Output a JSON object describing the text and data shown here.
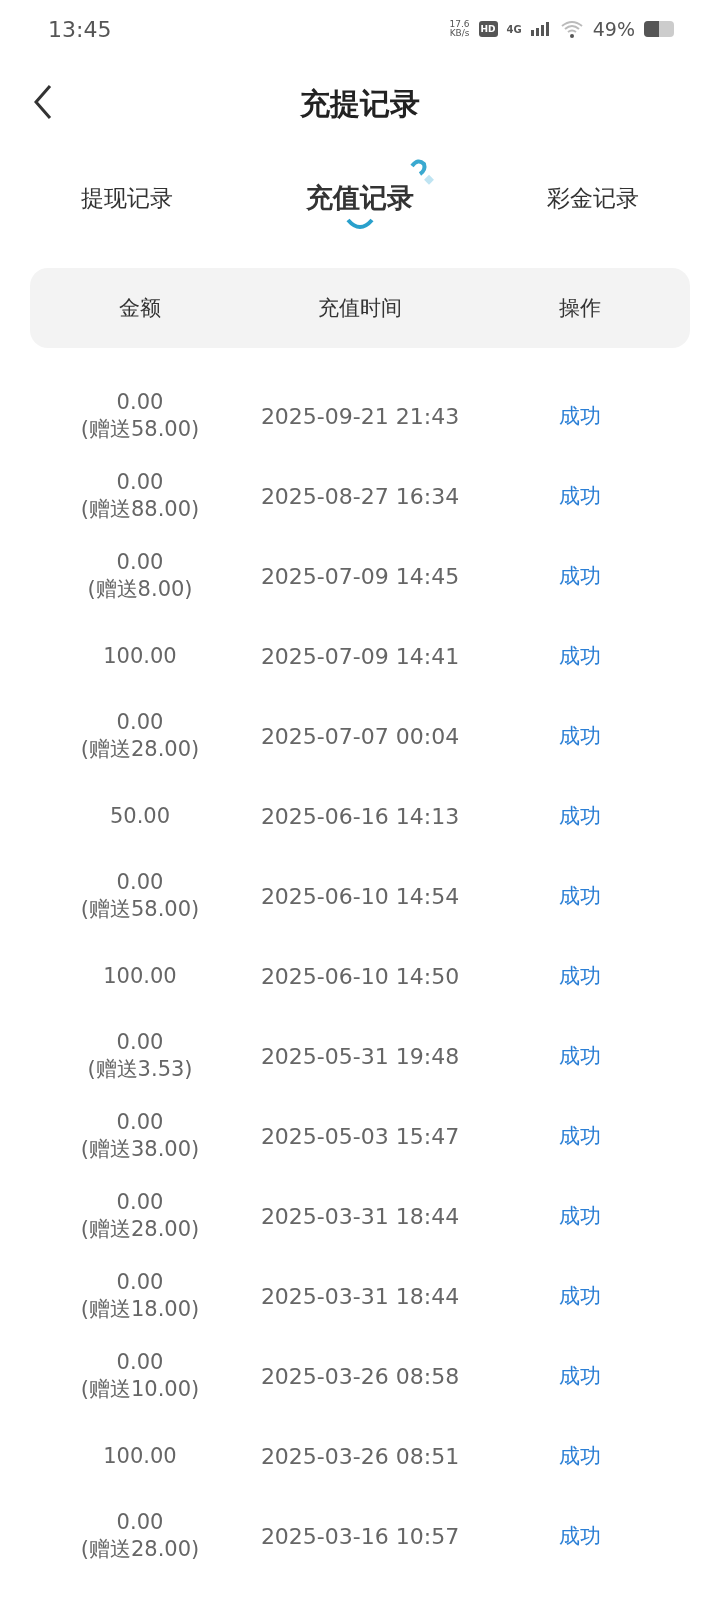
{
  "status_bar": {
    "time": "13:45",
    "speed": "17.6",
    "speed_unit": "KB/s",
    "hd": "HD",
    "network": "4G",
    "battery": "49%"
  },
  "header": {
    "title": "充提记录"
  },
  "tabs": [
    {
      "label": "提现记录",
      "selected": false
    },
    {
      "label": "充值记录",
      "selected": true
    },
    {
      "label": "彩金记录",
      "selected": false
    }
  ],
  "table": {
    "columns": [
      "金额",
      "充值时间",
      "操作"
    ],
    "rows": [
      {
        "amount": "0.00",
        "bonus": "(赠送58.00)",
        "time": "2025-09-21 21:43",
        "status": "成功"
      },
      {
        "amount": "0.00",
        "bonus": "(赠送88.00)",
        "time": "2025-08-27 16:34",
        "status": "成功"
      },
      {
        "amount": "0.00",
        "bonus": "(赠送8.00)",
        "time": "2025-07-09 14:45",
        "status": "成功"
      },
      {
        "amount": "100.00",
        "time": "2025-07-09 14:41",
        "status": "成功"
      },
      {
        "amount": "0.00",
        "bonus": "(赠送28.00)",
        "time": "2025-07-07 00:04",
        "status": "成功"
      },
      {
        "amount": "50.00",
        "time": "2025-06-16 14:13",
        "status": "成功"
      },
      {
        "amount": "0.00",
        "bonus": "(赠送58.00)",
        "time": "2025-06-10 14:54",
        "status": "成功"
      },
      {
        "amount": "100.00",
        "time": "2025-06-10 14:50",
        "status": "成功"
      },
      {
        "amount": "0.00",
        "bonus": "(赠送3.53)",
        "time": "2025-05-31 19:48",
        "status": "成功"
      },
      {
        "amount": "0.00",
        "bonus": "(赠送38.00)",
        "time": "2025-05-03 15:47",
        "status": "成功"
      },
      {
        "amount": "0.00",
        "bonus": "(赠送28.00)",
        "time": "2025-03-31 18:44",
        "status": "成功"
      },
      {
        "amount": "0.00",
        "bonus": "(赠送18.00)",
        "time": "2025-03-31 18:44",
        "status": "成功"
      },
      {
        "amount": "0.00",
        "bonus": "(赠送10.00)",
        "time": "2025-03-26 08:58",
        "status": "成功"
      },
      {
        "amount": "100.00",
        "time": "2025-03-26 08:51",
        "status": "成功"
      },
      {
        "amount": "0.00",
        "bonus": "(赠送28.00)",
        "time": "2025-03-16 10:57",
        "status": "成功"
      }
    ]
  }
}
